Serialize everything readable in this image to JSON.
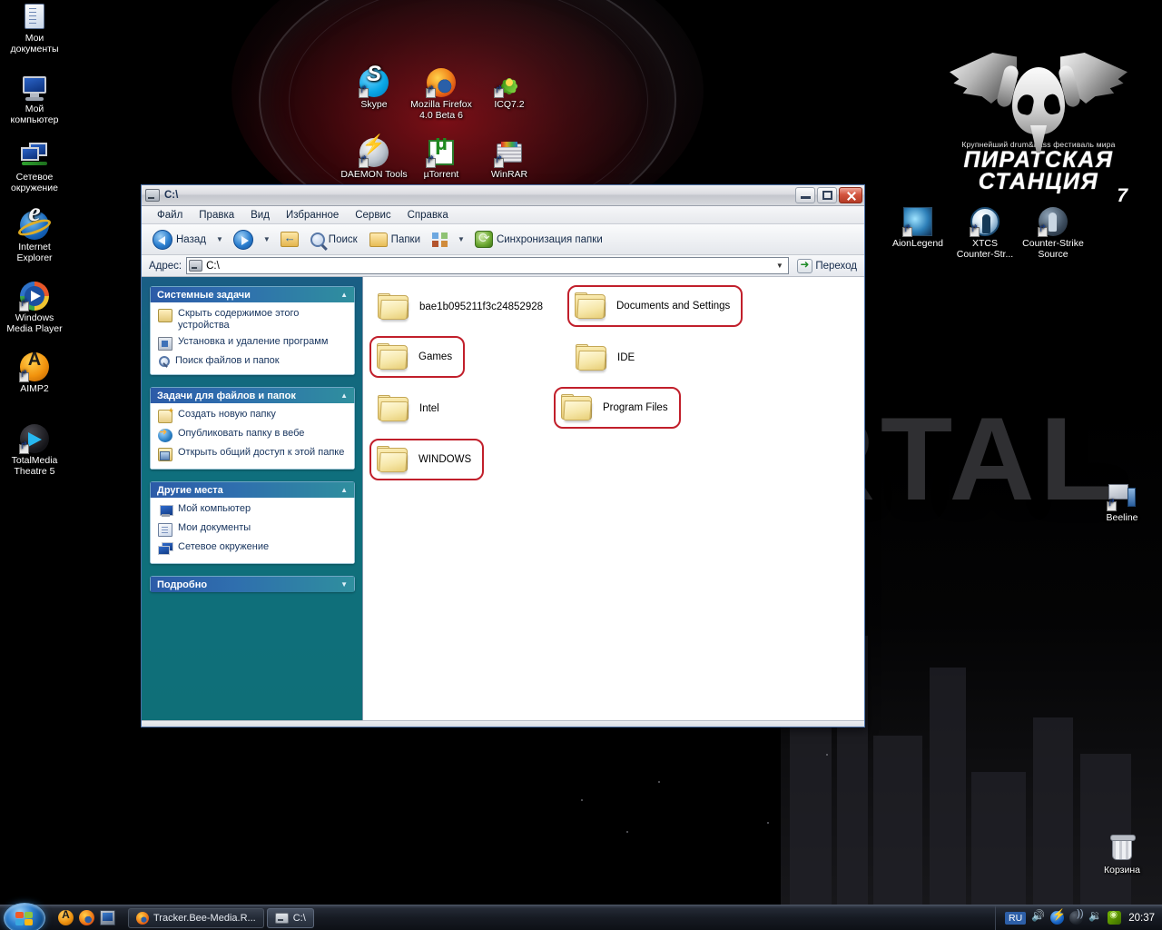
{
  "desktop": {
    "wallpaper": {
      "logo_tagline": "Крупнейший drum&bass фестиваль мира",
      "logo_line1": "ПИРАТСКАЯ",
      "logo_line2": "СТАНЦИЯ",
      "logo_reg": "®",
      "logo_seven": "7",
      "watermark_text": "RTAL"
    },
    "icons_left": [
      {
        "label": "Мои\nдокументы",
        "icon": "my-documents-icon"
      },
      {
        "label": "Мой\nкомпьютер",
        "icon": "my-computer-icon"
      },
      {
        "label": "Сетевое\nокружение",
        "icon": "network-places-icon"
      },
      {
        "label": "Internet\nExplorer",
        "icon": "internet-explorer-icon"
      },
      {
        "label": "Windows\nMedia Player",
        "icon": "windows-media-player-icon"
      },
      {
        "label": "AIMP2",
        "icon": "aimp2-icon"
      },
      {
        "label": "TotalMedia\nTheatre 5",
        "icon": "totalmedia-theatre-icon"
      }
    ],
    "icons_center": [
      {
        "label": "Skype",
        "icon": "skype-icon"
      },
      {
        "label": "Mozilla Firefox\n4.0 Beta 6",
        "icon": "firefox-icon"
      },
      {
        "label": "ICQ7.2",
        "icon": "icq-icon"
      },
      {
        "label": "DAEMON Tools",
        "icon": "daemon-tools-icon"
      },
      {
        "label": "µTorrent",
        "icon": "utorrent-icon"
      },
      {
        "label": "WinRAR",
        "icon": "winrar-icon"
      }
    ],
    "icons_right": [
      {
        "label": "AionLegend",
        "icon": "aion-legend-icon"
      },
      {
        "label": "XTCS\nCounter-Str...",
        "icon": "xtcs-counterstrike-icon"
      },
      {
        "label": "Counter-Strike\nSource",
        "icon": "counter-strike-source-icon"
      },
      {
        "label": "Beeline",
        "icon": "beeline-icon"
      },
      {
        "label": "Корзина",
        "icon": "recycle-bin-icon"
      }
    ]
  },
  "explorer": {
    "title": "C:\\",
    "window_buttons": {
      "minimize": "Свернуть",
      "maximize": "Развернуть",
      "close": "Закрыть"
    },
    "menu": [
      "Файл",
      "Правка",
      "Вид",
      "Избранное",
      "Сервис",
      "Справка"
    ],
    "toolbar": {
      "back": "Назад",
      "search": "Поиск",
      "folders": "Папки",
      "sync": "Синхронизация папки"
    },
    "address": {
      "label": "Адрес:",
      "value": "C:\\",
      "go": "Переход"
    },
    "sidebar": [
      {
        "title": "Системные задачи",
        "expanded": true,
        "items": [
          {
            "label": "Скрыть содержимое этого устройства",
            "icon": "hide-contents-icon"
          },
          {
            "label": "Установка и удаление программ",
            "icon": "add-remove-programs-icon"
          },
          {
            "label": "Поиск файлов и папок",
            "icon": "search-files-icon"
          }
        ]
      },
      {
        "title": "Задачи для файлов и папок",
        "expanded": true,
        "items": [
          {
            "label": "Создать новую папку",
            "icon": "new-folder-icon"
          },
          {
            "label": "Опубликовать папку в вебе",
            "icon": "publish-web-icon"
          },
          {
            "label": "Открыть общий доступ к этой папке",
            "icon": "share-folder-icon"
          }
        ]
      },
      {
        "title": "Другие места",
        "expanded": true,
        "items": [
          {
            "label": "Мой компьютер",
            "icon": "my-computer-icon"
          },
          {
            "label": "Мои документы",
            "icon": "my-documents-icon"
          },
          {
            "label": "Сетевое окружение",
            "icon": "network-places-icon"
          }
        ]
      },
      {
        "title": "Подробно",
        "expanded": false,
        "items": []
      }
    ],
    "folders": [
      {
        "name": "bae1b095211f3c24852928",
        "col": 0,
        "row": 0,
        "highlighted": false
      },
      {
        "name": "Documents and Settings",
        "col": 1,
        "row": 0,
        "highlighted": true
      },
      {
        "name": "Games",
        "col": 0,
        "row": 1,
        "highlighted": true
      },
      {
        "name": "IDE",
        "col": 1,
        "row": 1,
        "highlighted": false
      },
      {
        "name": "Intel",
        "col": 0,
        "row": 2,
        "highlighted": false
      },
      {
        "name": "Program Files",
        "col": 1,
        "row": 2,
        "highlighted": true
      },
      {
        "name": "WINDOWS",
        "col": 0,
        "row": 3,
        "highlighted": true
      }
    ],
    "highlight_color": "#c11f2b"
  },
  "taskbar": {
    "start_label": "Пуск",
    "quicklaunch": [
      {
        "name": "aimp-quicklaunch",
        "icon": "aimp2-icon"
      },
      {
        "name": "firefox-quicklaunch",
        "icon": "firefox-icon"
      },
      {
        "name": "show-desktop-quicklaunch",
        "icon": "show-desktop-icon"
      }
    ],
    "buttons": [
      {
        "label": "Tracker.Bee-Media.R...",
        "icon": "firefox-icon",
        "active": false
      },
      {
        "label": "C:\\",
        "icon": "drive-icon",
        "active": true
      }
    ],
    "tray": {
      "language": "RU",
      "icons": [
        "volume-red-icon",
        "daemon-tools-icon",
        "network-icon",
        "volume-icon",
        "nvidia-icon"
      ],
      "clock": "20:37"
    }
  }
}
